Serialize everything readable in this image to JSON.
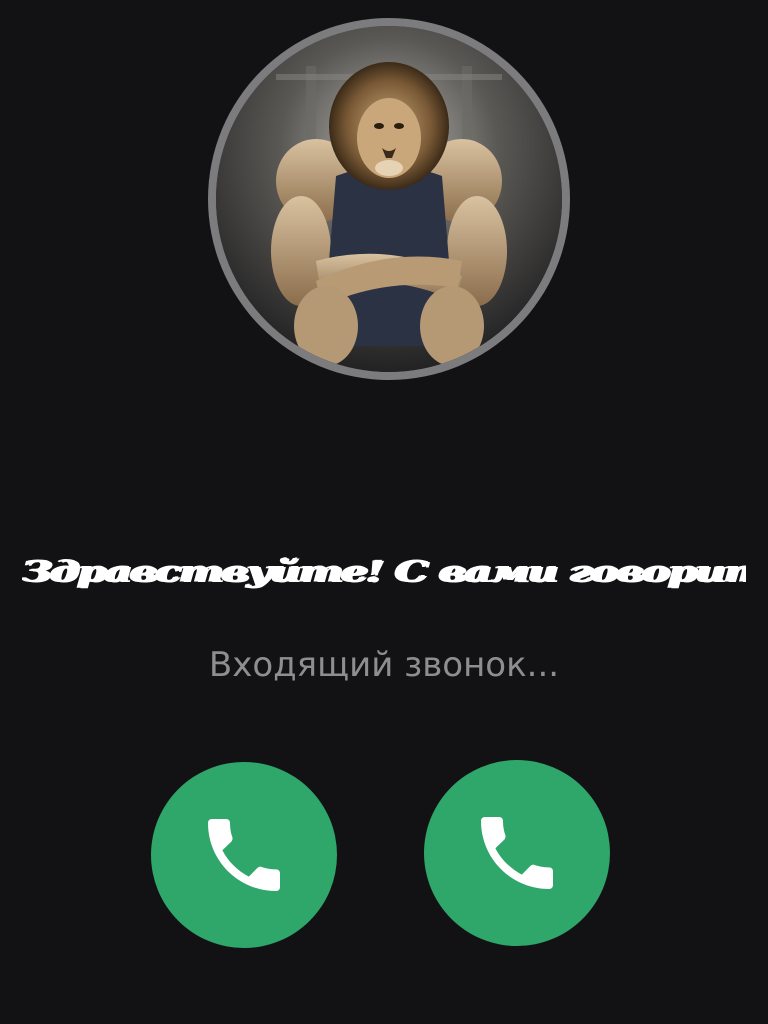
{
  "call": {
    "caller_name": "Здравствуйте! С вами говорит ваш тренер...",
    "status_text": "Входящий звонок..."
  },
  "avatar": {
    "description_icon": "lion-bodybuilder-avatar"
  },
  "buttons": {
    "left_icon": "phone-icon",
    "right_icon": "phone-icon"
  },
  "colors": {
    "background": "#121214",
    "accept_green": "#2fa66a",
    "status_gray": "#8e8e90",
    "ring_gray": "#7c7c7e"
  }
}
